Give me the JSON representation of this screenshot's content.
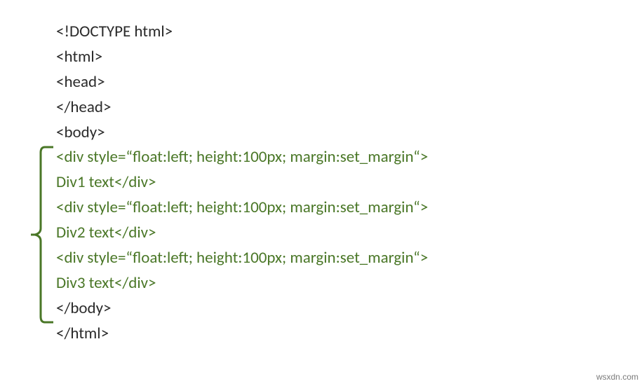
{
  "code": {
    "line1": "<!DOCTYPE html>",
    "line2": "<html>",
    "line3": "<head>",
    "line4": "</head>",
    "line5": "<body>",
    "line6": "<div style=“float:left; height:100px; margin:set_margin“>",
    "line7": "Div1 text</div>",
    "line8": "<div style=“float:left; height:100px; margin:set_margin“>",
    "line9": "Div2 text</div>",
    "line10": "<div style=“float:left; height:100px; margin:set_margin“>",
    "line11": "Div3 text</div>",
    "line12": "</body>",
    "line13": "</html>"
  },
  "watermark": "wsxdn.com"
}
